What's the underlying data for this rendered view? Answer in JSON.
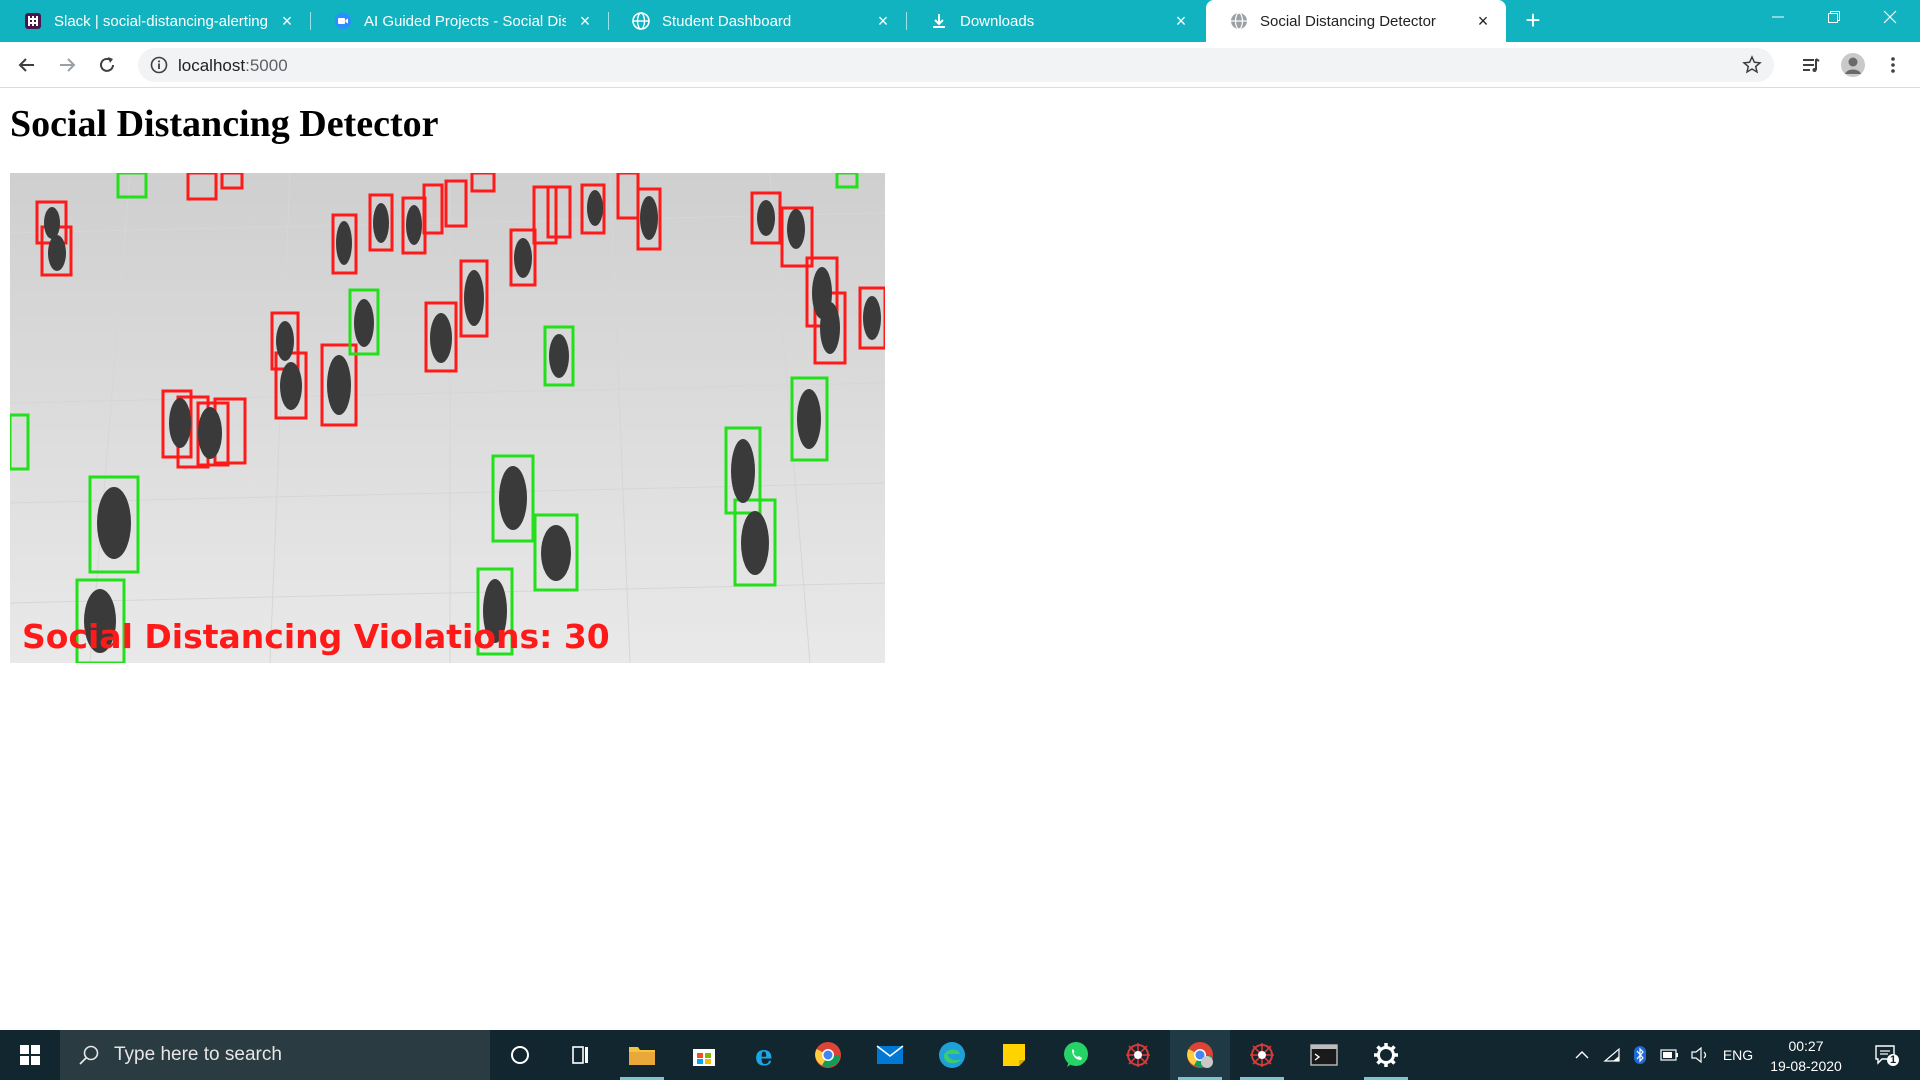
{
  "browser": {
    "tabs": [
      {
        "title": "Slack | social-distancing-alerting",
        "favicon": "slack-icon",
        "active": false
      },
      {
        "title": "AI Guided Projects - Social Distan",
        "favicon": "zoom-icon",
        "active": false
      },
      {
        "title": "Student Dashboard",
        "favicon": "globe-icon",
        "active": false
      },
      {
        "title": "Downloads",
        "favicon": "download-icon",
        "active": false
      },
      {
        "title": "Social Distancing Detector",
        "favicon": "globe-icon",
        "active": true
      }
    ],
    "url_host": "localhost",
    "url_port": ":5000",
    "colors": {
      "tabbar": "#10b3bf",
      "active_tab": "#ffffff"
    }
  },
  "page": {
    "title": "Social Distancing Detector",
    "feed": {
      "overlay_text": "Social Distancing Violations: 30",
      "violations": 30,
      "colors": {
        "violation_box": "#ff1a1a",
        "safe_box": "#22e01a"
      }
    }
  },
  "taskbar": {
    "search_placeholder": "Type here to search",
    "language": "ENG",
    "time": "00:27",
    "date": "19-08-2020",
    "notification_count": "1",
    "apps": [
      "cortana-icon",
      "task-view-icon",
      "file-explorer-icon",
      "store-icon",
      "internet-explorer-icon",
      "chrome-icon",
      "mail-icon",
      "edge-icon",
      "sticky-notes-icon",
      "whatsapp-icon",
      "spider-app-icon",
      "chrome-profile-icon",
      "spider-app-icon",
      "terminal-icon",
      "settings-icon"
    ]
  }
}
